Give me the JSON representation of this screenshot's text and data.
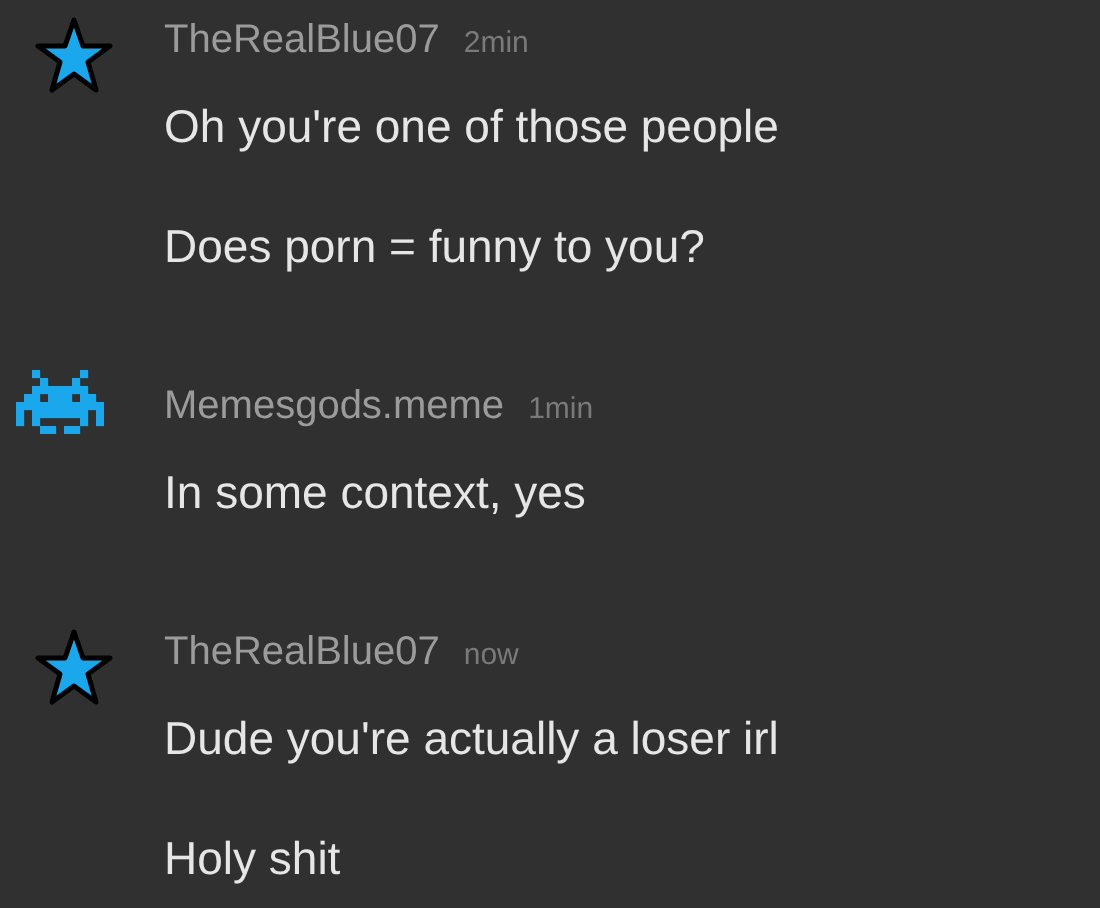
{
  "messages": [
    {
      "author": "TheRealBlue07",
      "time": "2min",
      "kind": "star",
      "lines": [
        "Oh you're one of those people",
        "Does porn = funny to you?"
      ]
    },
    {
      "author": "Memesgods.meme",
      "time": "1min",
      "kind": "invader",
      "lines": [
        "In some context, yes"
      ]
    },
    {
      "author": "TheRealBlue07",
      "time": "now",
      "kind": "star",
      "lines": [
        "Dude you're actually a loser irl",
        "Holy shit"
      ]
    }
  ]
}
